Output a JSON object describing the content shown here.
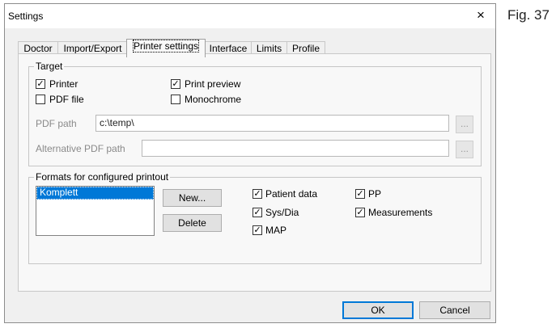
{
  "window": {
    "title": "Settings",
    "close_glyph": "×"
  },
  "figure_label": "Fig. 37",
  "tabs": [
    {
      "label": "Doctor"
    },
    {
      "label": "Import/Export"
    },
    {
      "label": "Printer settings"
    },
    {
      "label": "Interface"
    },
    {
      "label": "Limits"
    },
    {
      "label": "Profile"
    }
  ],
  "active_tab": "Printer settings",
  "target": {
    "legend": "Target",
    "printer": {
      "label": "Printer",
      "checked": true
    },
    "pdf_file": {
      "label": "PDF file",
      "checked": false
    },
    "print_preview": {
      "label": "Print preview",
      "checked": true
    },
    "monochrome": {
      "label": "Monochrome",
      "checked": false
    },
    "pdf_path": {
      "label": "PDF path",
      "value": "c:\\temp\\",
      "button": "..."
    },
    "alt_pdf_path": {
      "label": "Alternative PDF path",
      "value": "",
      "button": "..."
    }
  },
  "formats": {
    "legend": "Formats for configured printout",
    "list_items": [
      "Komplett"
    ],
    "selected_item": "Komplett",
    "new_button": "New...",
    "delete_button": "Delete",
    "options": {
      "patient_data": {
        "label": "Patient data",
        "checked": true
      },
      "sys_dia": {
        "label": "Sys/Dia",
        "checked": true
      },
      "map": {
        "label": "MAP",
        "checked": true
      },
      "pp": {
        "label": "PP",
        "checked": true
      },
      "measurements": {
        "label": "Measurements",
        "checked": true
      }
    }
  },
  "footer": {
    "ok_label": "OK",
    "cancel_label": "Cancel"
  },
  "colors": {
    "selection": "#0078d7",
    "window_bg": "#f0f0f0"
  },
  "icons": {
    "check": "✓"
  }
}
